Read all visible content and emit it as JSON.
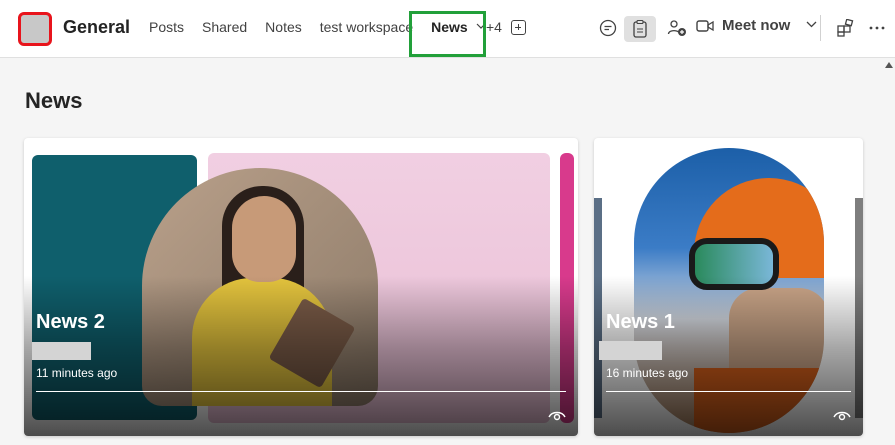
{
  "header": {
    "channel_name": "General",
    "tabs": [
      {
        "label": "Posts"
      },
      {
        "label": "Shared"
      },
      {
        "label": "Notes"
      },
      {
        "label": "test workspace"
      }
    ],
    "active_tab": {
      "label": "News"
    },
    "more_tabs": "+4",
    "meet_now_label": "Meet now",
    "icons": [
      "chat-icon",
      "notes-icon",
      "people-add-icon",
      "video-icon",
      "chevron-down-icon",
      "apps-icon",
      "more-icon",
      "add-tab-icon"
    ]
  },
  "page": {
    "title": "News"
  },
  "news_cards": [
    {
      "title": "News 2",
      "time": "11 minutes ago"
    },
    {
      "title": "News 1",
      "time": "16 minutes ago"
    }
  ],
  "colors": {
    "team_avatar_border": "#e8141c",
    "highlight": "#22a03a",
    "teal_panel": "#0f5f6c",
    "pink_panel": "#f1cfe2",
    "magenta_bar": "#d83a8c"
  }
}
